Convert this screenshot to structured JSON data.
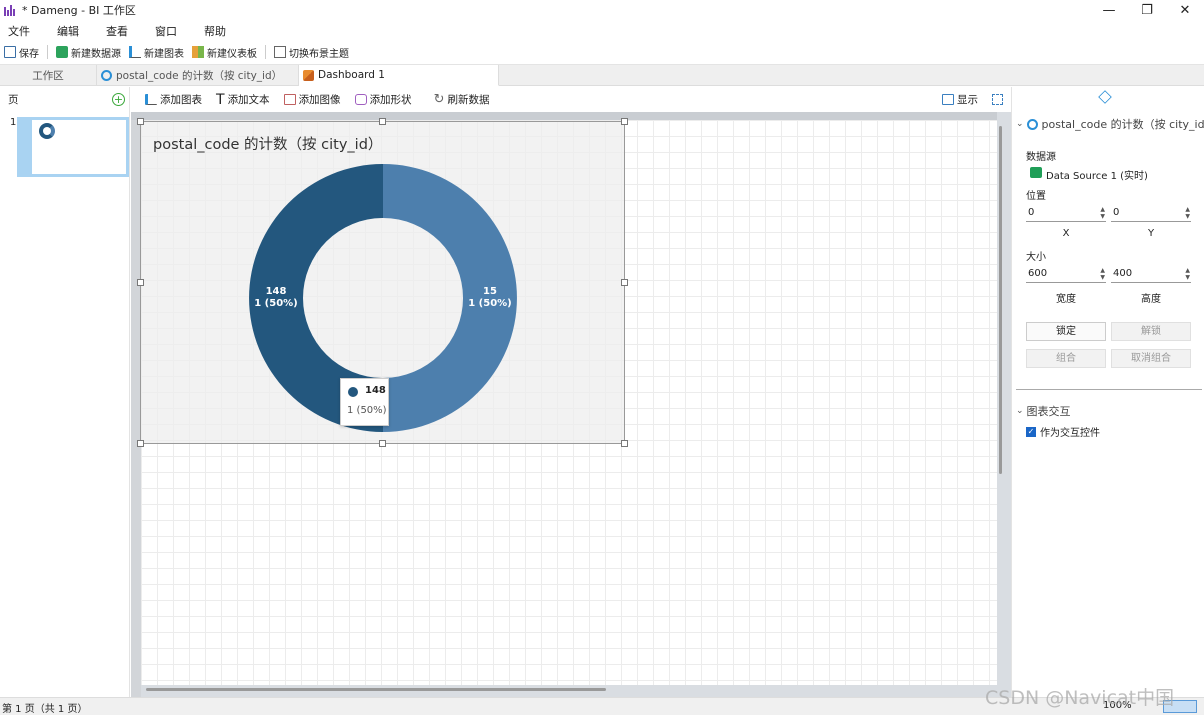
{
  "window": {
    "title": "* Dameng - BI 工作区",
    "controls": {
      "minimize": "—",
      "maximize": "❐",
      "close": "✕"
    }
  },
  "menu": [
    "文件",
    "编辑",
    "查看",
    "窗口",
    "帮助"
  ],
  "toolbar": {
    "save": "保存",
    "new_datasource": "新建数据源",
    "new_chart": "新建图表",
    "new_dashboard": "新建仪表板",
    "switch_theme": "切换布景主题"
  },
  "tabs": [
    {
      "label": "工作区"
    },
    {
      "label": "postal_code 的计数（按 city_id）"
    },
    {
      "label": "Dashboard 1"
    }
  ],
  "pages": {
    "header": "页",
    "add_icon": "+",
    "items": [
      {
        "num": "1"
      }
    ]
  },
  "canvas_toolbar": {
    "add_chart": "添加图表",
    "add_text": "添加文本",
    "add_image": "添加图像",
    "add_shape": "添加形状",
    "refresh": "刷新数据",
    "display": "显示"
  },
  "chart": {
    "title": "postal_code 的计数（按 city_id）",
    "tooltip": {
      "value": "148",
      "sub": "1 (50%)"
    }
  },
  "chart_data": {
    "type": "pie",
    "title": "postal_code 的计数（按 city_id）",
    "donut": true,
    "categories": [
      "15",
      "148"
    ],
    "values": [
      1,
      1
    ],
    "labels": [
      {
        "line1": "15",
        "line2": "1 (50%)"
      },
      {
        "line1": "148",
        "line2": "1 (50%)"
      }
    ],
    "colors": [
      "#4d7fad",
      "#23577e"
    ]
  },
  "properties": {
    "title": "postal_code 的计数（按 city_id）",
    "datasource_label": "数据源",
    "datasource_value": "Data Source 1 (实时)",
    "position_label": "位置",
    "x_value": "0",
    "y_value": "0",
    "x_label": "X",
    "y_label": "Y",
    "size_label": "大小",
    "width_value": "600",
    "height_value": "400",
    "width_label": "宽度",
    "height_label": "高度",
    "lock": "锁定",
    "unlock": "解锁",
    "group": "组合",
    "ungroup": "取消组合",
    "interaction_section": "图表交互",
    "interaction_checkbox": "作为交互控件"
  },
  "status": {
    "page_info": "第 1 页（共 1 页）",
    "zoom": "100%"
  },
  "watermark": "CSDN @Navicat中国"
}
